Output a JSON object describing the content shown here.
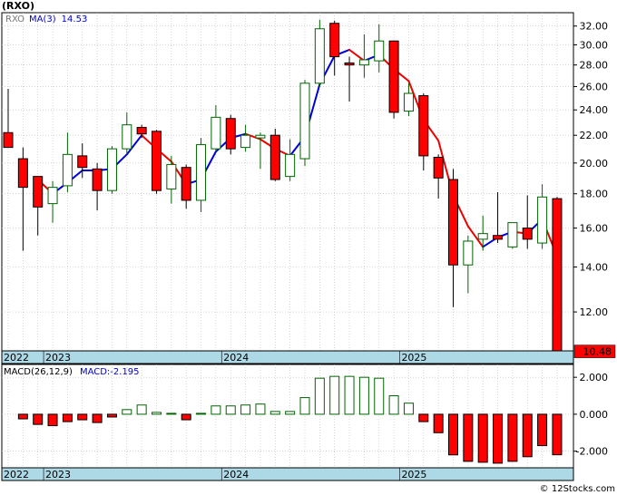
{
  "title": "(RXO)",
  "watermark": "© 12Stocks.com",
  "colors": {
    "up_fill": "#ffffff",
    "up_stroke": "#006400",
    "down_fill": "#ff0000",
    "down_stroke": "#000000",
    "ma_up": "#0000dd",
    "ma_down": "#ee0000",
    "grid": "#bbbbbb",
    "axis_band": "#add8e6",
    "last_price_box": "#ff0000",
    "legend_ticker": "#777777",
    "legend_ma": "#0000cc"
  },
  "chart_data": [
    {
      "type": "candlestick",
      "name": "price",
      "legend": {
        "ticker": "RXO",
        "ma_label": "MA(3)",
        "ma_value": "14.53"
      },
      "y_scale": "log",
      "ylim": [
        10.5,
        33.5
      ],
      "y_ticks": [
        12,
        14,
        16,
        18,
        20,
        22,
        24,
        26,
        28,
        30,
        32
      ],
      "y_tick_labels": [
        "12.00",
        "14.00",
        "16.00",
        "18.00",
        "20.00",
        "22.00",
        "24.00",
        "26.00",
        "28.00",
        "30.00",
        "32.00"
      ],
      "last_price": "10.48",
      "x_tick_labels": [
        "2022",
        "2023",
        "2024",
        "2025"
      ],
      "x_tick_index": [
        0,
        3,
        15,
        27
      ],
      "grid": true,
      "candles": [
        {
          "o": 22.2,
          "h": 25.8,
          "l": 21.8,
          "c": 21.1
        },
        {
          "o": 20.3,
          "h": 21.1,
          "l": 14.8,
          "c": 18.4
        },
        {
          "o": 19.1,
          "h": 19.1,
          "l": 15.6,
          "c": 17.2
        },
        {
          "o": 17.4,
          "h": 18.8,
          "l": 16.3,
          "c": 18.4
        },
        {
          "o": 18.5,
          "h": 22.2,
          "l": 18.1,
          "c": 20.6
        },
        {
          "o": 20.5,
          "h": 21.4,
          "l": 19.0,
          "c": 19.7
        },
        {
          "o": 19.6,
          "h": 20.0,
          "l": 17.0,
          "c": 18.2
        },
        {
          "o": 18.2,
          "h": 21.2,
          "l": 18.0,
          "c": 21.0
        },
        {
          "o": 21.0,
          "h": 23.8,
          "l": 20.6,
          "c": 22.8
        },
        {
          "o": 22.6,
          "h": 22.8,
          "l": 21.8,
          "c": 22.1
        },
        {
          "o": 22.3,
          "h": 22.4,
          "l": 18.0,
          "c": 18.2
        },
        {
          "o": 18.3,
          "h": 20.5,
          "l": 17.4,
          "c": 19.9
        },
        {
          "o": 19.7,
          "h": 19.9,
          "l": 17.1,
          "c": 17.6
        },
        {
          "o": 17.6,
          "h": 21.8,
          "l": 16.9,
          "c": 21.3
        },
        {
          "o": 21.0,
          "h": 24.4,
          "l": 20.8,
          "c": 23.4
        },
        {
          "o": 23.3,
          "h": 23.6,
          "l": 20.6,
          "c": 21.0
        },
        {
          "o": 21.1,
          "h": 22.8,
          "l": 20.8,
          "c": 22.0
        },
        {
          "o": 21.8,
          "h": 22.2,
          "l": 19.6,
          "c": 22.0
        },
        {
          "o": 22.0,
          "h": 22.5,
          "l": 18.8,
          "c": 18.9
        },
        {
          "o": 19.1,
          "h": 21.7,
          "l": 18.8,
          "c": 20.6
        },
        {
          "o": 20.3,
          "h": 26.6,
          "l": 19.8,
          "c": 26.3
        },
        {
          "o": 26.3,
          "h": 32.7,
          "l": 26.0,
          "c": 31.7
        },
        {
          "o": 32.3,
          "h": 32.6,
          "l": 27.0,
          "c": 28.8
        },
        {
          "o": 28.2,
          "h": 28.8,
          "l": 24.7,
          "c": 28.0
        },
        {
          "o": 28.0,
          "h": 31.1,
          "l": 26.8,
          "c": 28.5
        },
        {
          "o": 28.4,
          "h": 32.2,
          "l": 27.3,
          "c": 30.4
        },
        {
          "o": 30.4,
          "h": 30.4,
          "l": 23.3,
          "c": 23.8
        },
        {
          "o": 23.9,
          "h": 26.3,
          "l": 23.5,
          "c": 25.4
        },
        {
          "o": 25.2,
          "h": 25.4,
          "l": 19.5,
          "c": 20.5
        },
        {
          "o": 20.4,
          "h": 20.6,
          "l": 17.7,
          "c": 19.0
        },
        {
          "o": 18.9,
          "h": 19.6,
          "l": 12.2,
          "c": 14.1
        },
        {
          "o": 14.1,
          "h": 15.6,
          "l": 12.8,
          "c": 15.3
        },
        {
          "o": 15.4,
          "h": 16.7,
          "l": 14.8,
          "c": 15.7
        },
        {
          "o": 15.6,
          "h": 18.1,
          "l": 15.2,
          "c": 15.4
        },
        {
          "o": 15.0,
          "h": 16.3,
          "l": 14.9,
          "c": 16.3
        },
        {
          "o": 16.0,
          "h": 17.9,
          "l": 14.9,
          "c": 15.4
        },
        {
          "o": 15.2,
          "h": 18.6,
          "l": 14.9,
          "c": 17.8
        },
        {
          "o": 17.7,
          "h": 17.8,
          "l": 10.48,
          "c": 10.48
        }
      ],
      "ma": [
        null,
        null,
        18.9,
        18.0,
        18.7,
        19.5,
        19.5,
        19.6,
        20.6,
        22.0,
        21.0,
        20.1,
        18.6,
        18.9,
        20.8,
        21.8,
        22.1,
        21.7,
        21.0,
        20.5,
        21.9,
        26.2,
        28.9,
        29.5,
        28.4,
        29.0,
        27.6,
        26.5,
        23.2,
        21.6,
        17.9,
        16.1,
        15.0,
        15.5,
        15.8,
        15.7,
        16.5,
        14.53
      ]
    },
    {
      "type": "bar",
      "name": "macd",
      "legend": {
        "label": "MACD(26,12,9)",
        "value_label": "MACD:-2.195"
      },
      "ylim": [
        -2.9,
        2.45
      ],
      "y_ticks": [
        -2,
        0,
        2
      ],
      "y_tick_labels": [
        "-2.000",
        "0.000",
        "2.000"
      ],
      "x_tick_labels": [
        "2022",
        "2023",
        "2024",
        "2025"
      ],
      "x_tick_index": [
        0,
        3,
        15,
        27
      ],
      "grid": true,
      "values": [
        null,
        -0.25,
        -0.55,
        -0.62,
        -0.4,
        -0.3,
        -0.45,
        -0.15,
        0.25,
        0.5,
        0.1,
        0.05,
        -0.3,
        0.05,
        0.45,
        0.45,
        0.5,
        0.55,
        0.15,
        0.15,
        0.9,
        1.95,
        2.05,
        2.05,
        2.0,
        1.95,
        1.0,
        0.6,
        -0.4,
        -1.0,
        -2.2,
        -2.55,
        -2.6,
        -2.65,
        -2.55,
        -2.3,
        -1.7,
        -2.195
      ]
    }
  ]
}
